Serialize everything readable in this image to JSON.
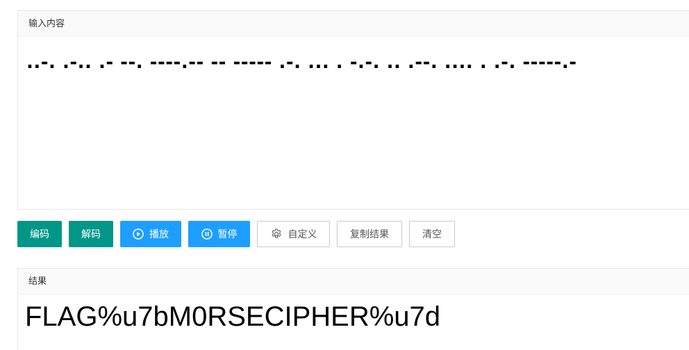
{
  "input_panel": {
    "title": "输入内容",
    "value": "..-. .-.. .- --. ----.-- -- ----- .-. ... . -.-. .. .--. .... . .-. -----.-"
  },
  "toolbar": {
    "encode_label": "编码",
    "decode_label": "解码",
    "play_label": "播放",
    "pause_label": "暂停",
    "custom_label": "自定义",
    "copy_label": "复制结果",
    "clear_label": "清空"
  },
  "result_panel": {
    "title": "结果",
    "value": "FLAG%u7bM0RSECIPHER%u7d"
  },
  "colors": {
    "green": "#009688",
    "blue": "#1e9fff"
  },
  "icons": {
    "play": "play-circle-icon",
    "pause": "pause-circle-icon",
    "custom": "gear-icon"
  }
}
